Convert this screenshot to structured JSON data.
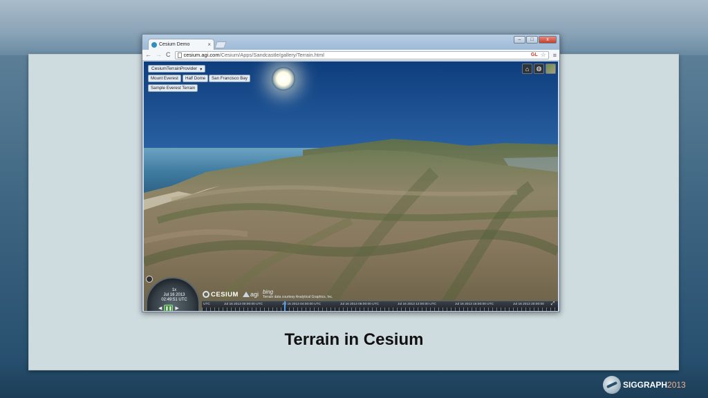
{
  "slide": {
    "caption": "Terrain in Cesium",
    "brand": "SIGGRAPH",
    "brand_year": "2013"
  },
  "browser": {
    "tab_title": "Cesium Demo",
    "tab_close": "×",
    "url_host": "cesium.agi.com",
    "url_path": "/Cesium/Apps/Sandcastle/gallery/Terrain.html",
    "gl_badge": "GL",
    "nav_back": "←",
    "nav_forward": "→",
    "nav_reload": "C",
    "star": "☆",
    "menu": "≡",
    "window_controls": {
      "minimize": "–",
      "maximize": "□",
      "close": "x"
    }
  },
  "viewer": {
    "dropdown_label": "CesiumTerrainProvider",
    "buttons": {
      "everest": "Mount Everest",
      "half_dome": "Half Dome",
      "sf_bay": "San Francisco Bay",
      "sample_everest": "Sample Everest Terrain"
    },
    "toolbar_icons": [
      "home-icon",
      "globe-icon",
      "imagery-layer-icon"
    ],
    "animation": {
      "speed": "1x",
      "date": "Jul 16 2013",
      "time": "02:49:51 UTC"
    },
    "credits": {
      "cesium": "CESIUM",
      "agi": "agi",
      "bing": "bing",
      "terrain_credit": "Terrain data courtesy Analytical Graphics, Inc."
    },
    "timeline_labels": [
      "UTC",
      "Jul 16 2013 00:00:00 UTC",
      "Jul 16 2013 04:00:00 UTC",
      "Jul 16 2013 08:00:00 UTC",
      "Jul 16 2013 12:00:00 UTC",
      "Jul 16 2013 16:00:00 UTC",
      "Jul 16 2013 20:00:00"
    ]
  }
}
